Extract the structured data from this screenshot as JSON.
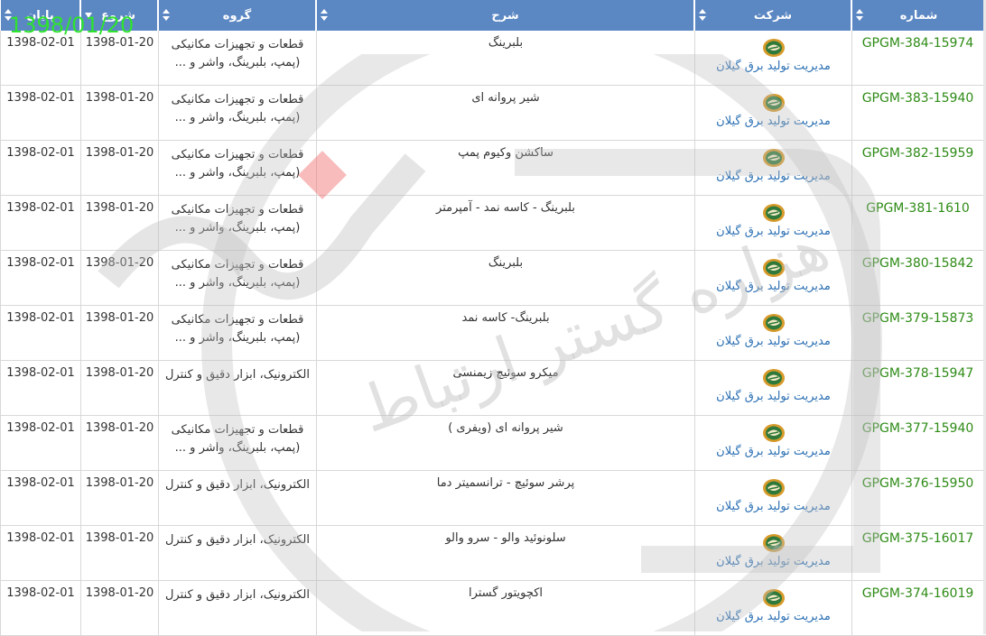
{
  "overlay_date": "1398/01/20",
  "columns": {
    "number": "شماره",
    "company": "شرکت",
    "description": "شرح",
    "group": "گروه",
    "start": "شروع",
    "end": "پایان"
  },
  "colors": {
    "header_bg": "#5b87c3",
    "number_text": "#2e8b16",
    "company_text": "#2a6fb3",
    "overlay_date": "#2ee32e"
  },
  "rows": [
    {
      "number": "GPGM-384-15974",
      "company": "مدیریت تولید برق گیلان",
      "description": "بلبرینگ",
      "group_line1": "قطعات و تجهیزات مکانیکی",
      "group_line2": "(پمپ، بلبرینگ، واشر و ...",
      "start": "1398-01-20",
      "end": "1398-02-01"
    },
    {
      "number": "GPGM-383-15940",
      "company": "مدیریت تولید برق گیلان",
      "description": "شیر پروانه ای",
      "group_line1": "قطعات و تجهیزات مکانیکی",
      "group_line2": "(پمپ، بلبرینگ، واشر و ...",
      "start": "1398-01-20",
      "end": "1398-02-01"
    },
    {
      "number": "GPGM-382-15959",
      "company": "مدیریت تولید برق گیلان",
      "description": "ساکشن وکیوم پمپ",
      "group_line1": "قطعات و تجهیزات مکانیکی",
      "group_line2": "(پمپ، بلبرینگ، واشر و ...",
      "start": "1398-01-20",
      "end": "1398-02-01"
    },
    {
      "number": "GPGM-381-1610",
      "company": "مدیریت تولید برق گیلان",
      "description": "بلبرینگ - کاسه نمد - آمپرمتر",
      "group_line1": "قطعات و تجهیزات مکانیکی",
      "group_line2": "(پمپ، بلبرینگ، واشر و ...",
      "start": "1398-01-20",
      "end": "1398-02-01"
    },
    {
      "number": "GPGM-380-15842",
      "company": "مدیریت تولید برق گیلان",
      "description": "بلبرینگ",
      "group_line1": "قطعات و تجهیزات مکانیکی",
      "group_line2": "(پمپ، بلبرینگ، واشر و ...",
      "start": "1398-01-20",
      "end": "1398-02-01"
    },
    {
      "number": "GPGM-379-15873",
      "company": "مدیریت تولید برق گیلان",
      "description": "بلبرینگ- کاسه نمد",
      "group_line1": "قطعات و تجهیزات مکانیکی",
      "group_line2": "(پمپ، بلبرینگ، واشر و ...",
      "start": "1398-01-20",
      "end": "1398-02-01"
    },
    {
      "number": "GPGM-378-15947",
      "company": "مدیریت تولید برق گیلان",
      "description": "میکرو سوئیچ زیمنسی",
      "group_line1": "الکترونیک، ابزار دقیق و کنترل",
      "group_line2": "",
      "start": "1398-01-20",
      "end": "1398-02-01"
    },
    {
      "number": "GPGM-377-15940",
      "company": "مدیریت تولید برق گیلان",
      "description": "شیر پروانه ای (ویفری )",
      "group_line1": "قطعات و تجهیزات مکانیکی",
      "group_line2": "(پمپ، بلبرینگ، واشر و ...",
      "start": "1398-01-20",
      "end": "1398-02-01"
    },
    {
      "number": "GPGM-376-15950",
      "company": "مدیریت تولید برق گیلان",
      "description": "پرشر سوئیچ - ترانسمیتر دما",
      "group_line1": "الکترونیک، ابزار دقیق و کنترل",
      "group_line2": "",
      "start": "1398-01-20",
      "end": "1398-02-01"
    },
    {
      "number": "GPGM-375-16017",
      "company": "مدیریت تولید برق گیلان",
      "description": "سلونوئید والو - سرو والو",
      "group_line1": "الکترونیک، ابزار دقیق و کنترل",
      "group_line2": "",
      "start": "1398-01-20",
      "end": "1398-02-01"
    },
    {
      "number": "GPGM-374-16019",
      "company": "مدیریت تولید برق گیلان",
      "description": "اکچویتور گسترا",
      "group_line1": "الکترونیک، ابزار دقیق و کنترل",
      "group_line2": "",
      "start": "1398-01-20",
      "end": "1398-02-01"
    }
  ],
  "watermark_text": "هزاره گستر ارتباط"
}
